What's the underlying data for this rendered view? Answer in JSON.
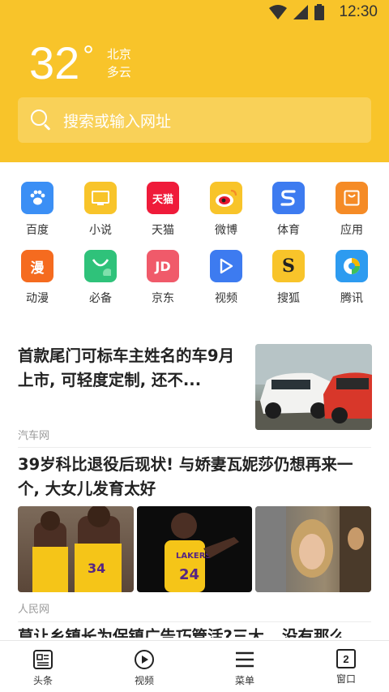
{
  "status": {
    "time": "12:30"
  },
  "weather": {
    "temperature": "32",
    "degree_symbol": "°",
    "city": "北京",
    "condition": "多云"
  },
  "search": {
    "placeholder": "搜索或输入网址"
  },
  "apps": [
    {
      "label": "百度",
      "icon": "baidu-paw-icon",
      "color": "#3b8ff5"
    },
    {
      "label": "小说",
      "icon": "book-icon",
      "color": "#f8c42a"
    },
    {
      "label": "天猫",
      "icon": "tmall-icon",
      "glyph": "天猫",
      "color": "#ef1b3a"
    },
    {
      "label": "微博",
      "icon": "weibo-icon",
      "color": "#f8c42a"
    },
    {
      "label": "体育",
      "icon": "sports-s-icon",
      "color": "#3d7bf0"
    },
    {
      "label": "应用",
      "icon": "app-store-icon",
      "color": "#f58b26"
    },
    {
      "label": "动漫",
      "icon": "anime-icon",
      "glyph": "漫",
      "color": "#f56b1f"
    },
    {
      "label": "必备",
      "icon": "shopping-bag-icon",
      "color": "#2fc27a"
    },
    {
      "label": "京东",
      "icon": "jd-icon",
      "glyph": "JD",
      "color": "#f05a6a"
    },
    {
      "label": "视频",
      "icon": "play-icon",
      "color": "#3d7bf0"
    },
    {
      "label": "搜狐",
      "icon": "sohu-icon",
      "glyph": "S",
      "color": "#f8c42a"
    },
    {
      "label": "腾讯",
      "icon": "tencent-icon",
      "color": "#2d9bf0"
    }
  ],
  "news": [
    {
      "title": "首款尾门可标车主姓名的车9月上市, 可轻度定制, 还不...",
      "source": "汽车网",
      "image": "cars-thumbnail"
    },
    {
      "title": "39岁科比退役后现状! 与娇妻瓦妮莎仍想再来一个, 大女儿发育太好",
      "source": "人民网",
      "images": [
        "lakers-players-photo",
        "kobe-pointing-photo",
        "vanessa-selfie-photo"
      ]
    },
    {
      "title_peek": "莫让乡镇长为保镇广告巧管活?三大...没有那么"
    }
  ],
  "tabs": [
    {
      "label": "头条",
      "icon": "news-icon"
    },
    {
      "label": "视频",
      "icon": "play-circle-icon"
    },
    {
      "label": "菜单",
      "icon": "menu-icon"
    },
    {
      "label": "窗口",
      "icon": "window-count-icon",
      "count": "2"
    }
  ]
}
